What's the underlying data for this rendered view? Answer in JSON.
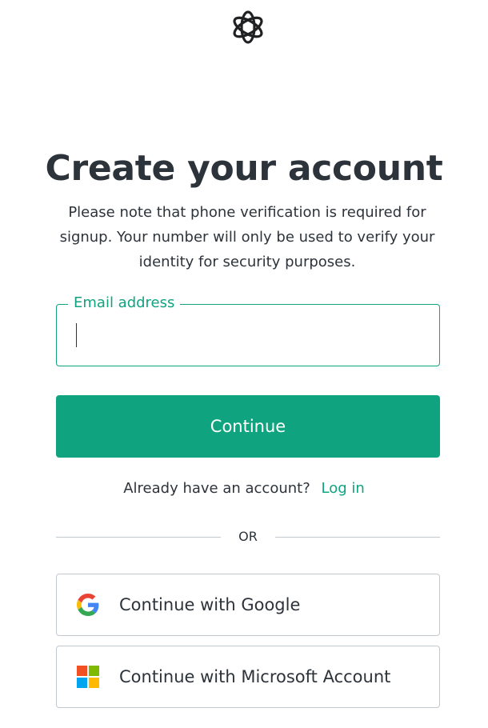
{
  "logo": {
    "icon": "openai-logo-icon"
  },
  "heading": "Create your account",
  "subtitle": "Please note that phone verification is required for signup. Your number will only be used to verify your identity for security purposes.",
  "email": {
    "label": "Email address",
    "value": ""
  },
  "continue_label": "Continue",
  "login": {
    "prompt": "Already have an account?",
    "link": "Log in"
  },
  "divider": "OR",
  "social": {
    "google": {
      "label": "Continue with Google",
      "icon": "google-icon"
    },
    "microsoft": {
      "label": "Continue with Microsoft Account",
      "icon": "microsoft-icon"
    }
  },
  "colors": {
    "accent": "#10a37f",
    "text": "#2d333a",
    "border": "#c2c8d0"
  }
}
